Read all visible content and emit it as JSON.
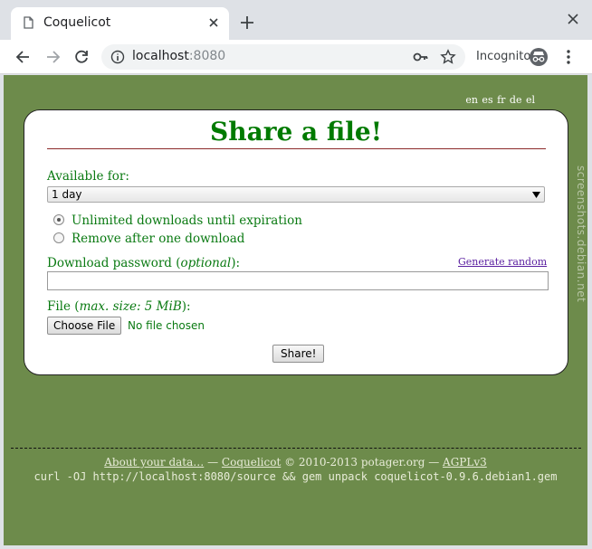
{
  "browser": {
    "tab_title": "Coquelicot",
    "url_host": "localhost",
    "url_port": ":8080",
    "incognito_label": "Incognito",
    "icons": [
      "document-icon",
      "close-icon",
      "plus-icon",
      "back-icon",
      "forward-icon",
      "reload-icon",
      "info-icon",
      "key-icon",
      "star-icon",
      "incognito-icon",
      "menu-icon"
    ]
  },
  "page": {
    "languages": "en es fr de el",
    "title": "Share a file!",
    "available_label": "Available for:",
    "available_value": "1 day",
    "radio_unlimited": "Unlimited downloads until expiration",
    "radio_once": "Remove after one download",
    "password_label_pre": "Download password (",
    "password_label_em": "optional",
    "password_label_post": "):",
    "generate_random": "Generate random",
    "file_label_pre": "File (",
    "file_label_em": "max. size: 5 MiB",
    "file_label_post": "):",
    "choose_file": "Choose File",
    "no_file": "No file chosen",
    "share_button": "Share!",
    "watermark": "screenshots.debian.net"
  },
  "footer": {
    "about": "About your data…",
    "sep1": " — ",
    "coquelicot": "Coquelicot",
    "copyright": " © 2010-2013 potager.org — ",
    "license": "AGPLv3",
    "command": "curl -OJ http://localhost:8080/source && gem unpack coquelicot-0.9.6.debian1.gem"
  },
  "colors": {
    "background": "#6d8b4b",
    "title": "#007a00",
    "text": "#0a7a12",
    "link": "#5a1fa0"
  }
}
